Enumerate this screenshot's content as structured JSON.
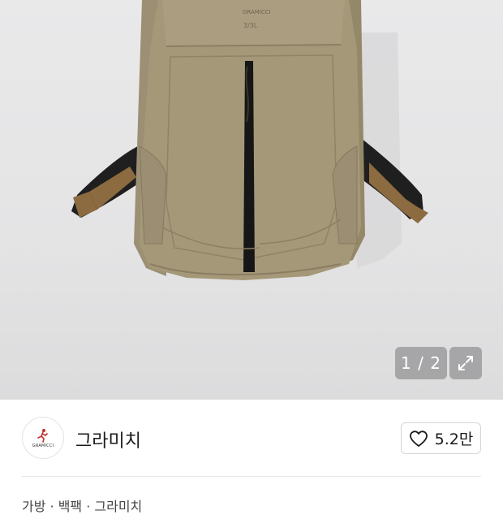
{
  "gallery": {
    "current": "1",
    "total": "2",
    "counter_text": "1 / 2",
    "icons": {
      "fullscreen": "expand-arrows-icon"
    },
    "colors": {
      "background": "#e6e6e7",
      "bag": "#a2957a",
      "strap": "#8a6a3e",
      "zipper": "#1a1a1a",
      "overlay": "#78787a"
    }
  },
  "shop": {
    "name": "그라미치",
    "logo_icon": "gramicci-running-man-logo",
    "likes": "5.2만",
    "like_icon": "heart-outline-icon"
  },
  "partial_text": "가방 · 백팩 · 그라미치"
}
